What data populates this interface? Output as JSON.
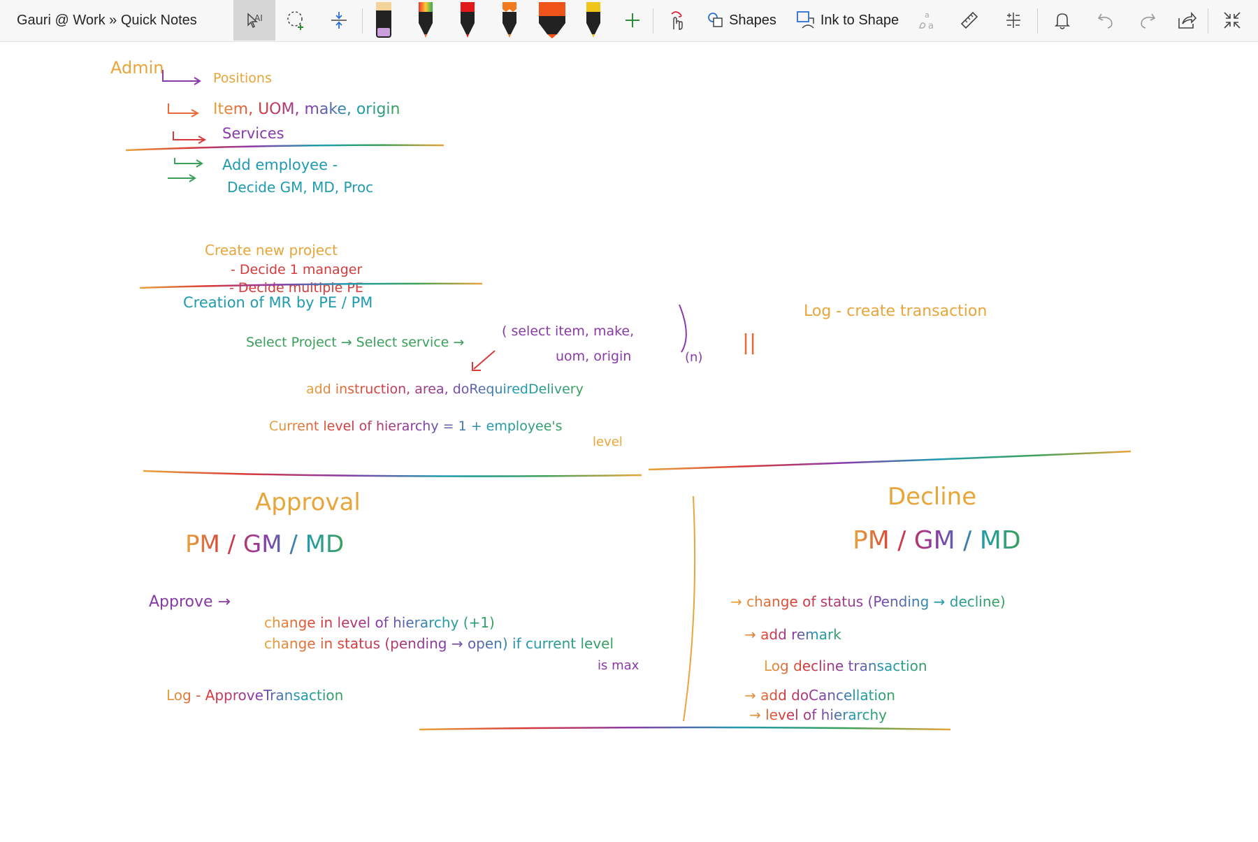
{
  "app": {
    "title": "Gauri @ Work » Quick Notes"
  },
  "toolbar": {
    "shapes_label": "Shapes",
    "ink_to_shape_label": "Ink to Shape",
    "math_label": "a"
  },
  "pens": [
    {
      "name": "highlighter-lilac",
      "color": "#c9a0dc"
    },
    {
      "name": "pen-rainbow",
      "color": "#e86a3a"
    },
    {
      "name": "pen-red",
      "color": "#e11a1a"
    },
    {
      "name": "pencil-orange",
      "color": "#f07a1c"
    },
    {
      "name": "marker-orange-red",
      "color": "#f0541b"
    },
    {
      "name": "pen-yellow",
      "color": "#f0c419"
    }
  ],
  "note": {
    "admin": {
      "heading": "Admin",
      "items": [
        "Positions",
        "Item, UOM, make, origin",
        "Services"
      ],
      "items2": [
        "Add employee -",
        "Decide GM, MD, Proc"
      ]
    },
    "project": {
      "heading": "Create new project",
      "items": [
        "- Decide 1 manager",
        "- Decide multiple PE"
      ]
    },
    "mr": {
      "heading": "Creation of MR by PE / PM",
      "flow_part1": "Select Project → Select service →",
      "flow_part2": "( select item, make,",
      "flow_part3": "uom, origin",
      "n_label": "(n)",
      "bars": "||",
      "log": "Log - create transaction",
      "add_line": "add instruction, area, doRequiredDelivery",
      "level_line": "Current level of hierarchy = 1 + employee's",
      "level_word": "level"
    },
    "approval": {
      "title": "Approval",
      "roles": "PM / GM / MD",
      "approve": "Approve →",
      "line1": "change in level of hierarchy (+1)",
      "line2": "change in status (pending → open) if current level",
      "line2b": "is max",
      "log": "Log - ApproveTransaction"
    },
    "decline": {
      "title": "Decline",
      "roles": "PM / GM / MD",
      "line1": "→ change of status (Pending → decline)",
      "line2": "→ add remark",
      "log": "Log decline transaction",
      "line3": "→ add doCancellation",
      "line4": "→ level of hierarchy"
    }
  },
  "colors": {
    "orange": "#e8a53a",
    "purple": "#8a3aa8",
    "teal": "#1f9bb0",
    "green": "#3aa05a",
    "red": "#d83a3a",
    "blue": "#3a6ad8"
  }
}
